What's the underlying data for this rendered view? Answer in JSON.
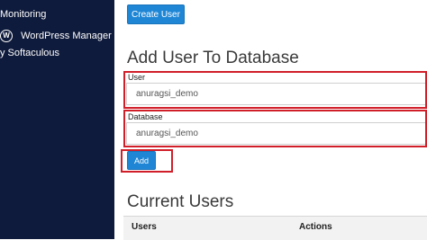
{
  "sidebar": {
    "items": [
      {
        "label": "Monitoring"
      },
      {
        "label": "WordPress Manager"
      },
      {
        "label": "y Softaculous"
      }
    ]
  },
  "main": {
    "create_user_button": "Create User",
    "add_user_title": "Add User To Database",
    "user_label": "User",
    "user_value": "anuragsi_demo",
    "database_label": "Database",
    "database_value": "anuragsi_demo",
    "add_button": "Add",
    "current_users_title": "Current Users",
    "table": {
      "headers": [
        "Users",
        "Actions"
      ]
    }
  },
  "colors": {
    "sidebar_bg": "#0f1b3c",
    "primary_button": "#1f86d6",
    "highlight_box": "#d11f2a"
  }
}
